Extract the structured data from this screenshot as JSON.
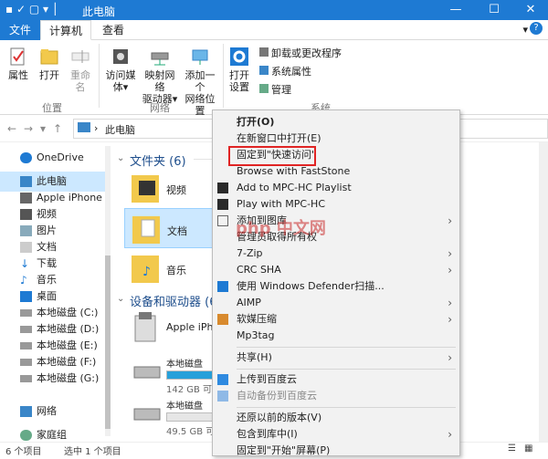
{
  "window": {
    "title": "此电脑",
    "controls": [
      "—",
      "☐",
      "✕"
    ],
    "help": "?"
  },
  "ribbon_tabs": {
    "file": "文件",
    "computer": "计算机",
    "view": "查看"
  },
  "ribbon": {
    "properties": "属性",
    "open": "打开",
    "rename": "重命名",
    "group_location": "位置",
    "access_media": "访问媒体",
    "map_drive_l1": "映射网络",
    "map_drive_l2": "驱动器",
    "add_location_l1": "添加一个",
    "add_location_l2": "网络位置",
    "group_network": "网络",
    "open_settings_l1": "打开",
    "open_settings_l2": "设置",
    "uninstall": "卸载或更改程序",
    "system_props": "系统属性",
    "manage": "管理",
    "group_system": "系统"
  },
  "address": {
    "path": "此电脑"
  },
  "sidebar": {
    "items": [
      {
        "label": "OneDrive"
      },
      {
        "label": "此电脑"
      },
      {
        "label": "Apple iPhone"
      },
      {
        "label": "视频"
      },
      {
        "label": "图片"
      },
      {
        "label": "文档"
      },
      {
        "label": "下载"
      },
      {
        "label": "音乐"
      },
      {
        "label": "桌面"
      },
      {
        "label": "本地磁盘 (C:)"
      },
      {
        "label": "本地磁盘 (D:)"
      },
      {
        "label": "本地磁盘 (E:)"
      },
      {
        "label": "本地磁盘 (F:)"
      },
      {
        "label": "本地磁盘 (G:)"
      },
      {
        "label": "网络"
      },
      {
        "label": "家庭组"
      }
    ]
  },
  "main": {
    "folders_header": "文件夹 (6)",
    "folders": [
      {
        "label": "视频"
      },
      {
        "label": "文档"
      },
      {
        "label": "音乐"
      }
    ],
    "devices_header": "设备和驱动器 (6)",
    "devices": [
      {
        "label": "Apple iPho"
      },
      {
        "label": "本地磁盘",
        "cap": "142 GB 可用",
        "fill": 0.55
      },
      {
        "label": "本地磁盘",
        "cap": "49.5 GB 可",
        "fill": 0.0
      }
    ]
  },
  "status": {
    "count": "6 个项目",
    "selected": "选中 1 个项目"
  },
  "context_menu": {
    "items": [
      {
        "label": "打开(O)",
        "bold": true
      },
      {
        "label": "在新窗口中打开(E)"
      },
      {
        "label": "固定到\"快速访问\""
      },
      {
        "label": "Browse with FastStone"
      },
      {
        "label": "Add to MPC-HC Playlist"
      },
      {
        "label": "Play with MPC-HC"
      },
      {
        "label": "添加到图库"
      },
      {
        "label": "管理员取得所有权"
      },
      {
        "label": "7-Zip"
      },
      {
        "label": "CRC SHA"
      },
      {
        "label": "使用 Windows Defender扫描..."
      },
      {
        "label": "AIMP"
      },
      {
        "label": "软媒压缩"
      },
      {
        "label": "Mp3tag"
      },
      {
        "label": "共享(H)"
      },
      {
        "label": "上传到百度云"
      },
      {
        "label": "自动备份到百度云"
      },
      {
        "label": "还原以前的版本(V)"
      },
      {
        "label": "包含到库中(I)"
      },
      {
        "label": "固定到\"开始\"屏幕(P)"
      }
    ]
  },
  "watermark": "php 中文网",
  "colors": {
    "accent": "#1e7ad3",
    "selection": "#cce8ff",
    "highlight_box": "#e02424"
  }
}
